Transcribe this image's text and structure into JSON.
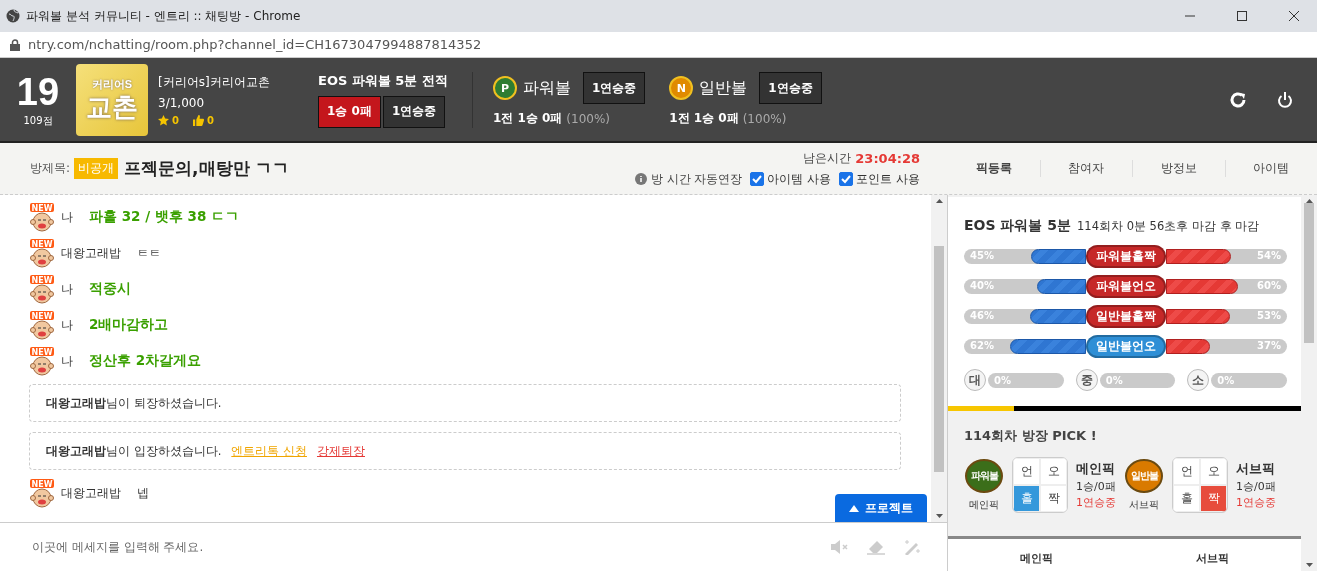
{
  "window": {
    "title": "파워볼 분석 커뮤니티 - 엔트리 :: 채팅방 - Chrome",
    "url": "ntry.com/nchatting/room.php?channel_id=CH1673047994887814352"
  },
  "header": {
    "rank": "19",
    "points": "109점",
    "logo": {
      "top": "커리어S",
      "main": "교촌"
    },
    "room_name": "[커리어s]커리어교촌",
    "members": "3/1,000",
    "stars": "0",
    "likes": "0",
    "record": {
      "title": "EOS 파워볼 5분 전적",
      "result": "1승 0패",
      "streak": "1연승중"
    },
    "balls": [
      {
        "letter": "P",
        "name": "파워볼",
        "streak": "1연승중",
        "summary": "1전 1승 0패",
        "rate": "(100%)",
        "color": "#2e7d32"
      },
      {
        "letter": "N",
        "name": "일반볼",
        "streak": "1연승중",
        "summary": "1전 1승 0패",
        "rate": "(100%)",
        "color": "#e08a00"
      }
    ]
  },
  "room": {
    "label": "방제목:",
    "badge": "비공개",
    "title": "프젝문의,매탕만 ㄱㄱ",
    "time_label": "남은시간",
    "time": "23:04:28",
    "auto_extend": "방 시간 자동연장",
    "options": [
      {
        "label": "아이템 사용",
        "checked": true
      },
      {
        "label": "포인트 사용",
        "checked": true
      }
    ],
    "tabs": [
      {
        "label": "픽등록",
        "selected": true
      },
      {
        "label": "참여자",
        "selected": false
      },
      {
        "label": "방정보",
        "selected": false
      },
      {
        "label": "아이템",
        "selected": false
      }
    ]
  },
  "messages": [
    {
      "kind": "chat",
      "badge": "NEW",
      "name": "나",
      "text": "파홀 32 / 뱃후 38 ㄷㄱ",
      "mine": true
    },
    {
      "kind": "chat",
      "badge": "NEW",
      "name": "대왕고래밥",
      "text": "ㅌㅌ",
      "mine": false
    },
    {
      "kind": "chat",
      "badge": "NEW",
      "name": "나",
      "text": "적중시",
      "mine": true
    },
    {
      "kind": "chat",
      "badge": "NEW",
      "name": "나",
      "text": "2배마감하고",
      "mine": true
    },
    {
      "kind": "chat",
      "badge": "NEW",
      "name": "나",
      "text": "정산후 2차갈게요",
      "mine": true
    },
    {
      "kind": "system",
      "name": "대왕고래밥",
      "text": "님이 퇴장하셨습니다."
    },
    {
      "kind": "system",
      "name": "대왕고래밥",
      "text": "님이 입장하셨습니다.",
      "links": [
        {
          "label": "엔트리톡 신청",
          "color": "#f0a500"
        },
        {
          "label": "강제퇴장",
          "color": "#e53935"
        }
      ]
    },
    {
      "kind": "chat",
      "badge": "NEW",
      "name": "대왕고래밥",
      "text": "넵",
      "mine": false
    }
  ],
  "input": {
    "placeholder": "이곳에 메세지를 입력해 주세요."
  },
  "project_button": "프로젝트",
  "stats": {
    "title": "EOS 파워볼 5분",
    "round_info": "114회차 0분 56초후 마감 후 마감",
    "bars": [
      {
        "label": "파워볼홀짝",
        "color": "#c62828",
        "left": {
          "reading": "45%",
          "level": 0.45
        },
        "right": {
          "reading": "54%",
          "level": 0.54
        }
      },
      {
        "label": "파워볼언오",
        "color": "#c62828",
        "left": {
          "reading": "40%",
          "level": 0.4
        },
        "right": {
          "reading": "60%",
          "level": 0.6
        }
      },
      {
        "label": "일반볼홀짝",
        "color": "#c62828",
        "left": {
          "reading": "46%",
          "level": 0.46
        },
        "right": {
          "reading": "53%",
          "level": 0.53
        }
      },
      {
        "label": "일반볼언오",
        "color": "#2e8fd6",
        "left": {
          "reading": "62%",
          "level": 0.62
        },
        "right": {
          "reading": "37%",
          "level": 0.37
        }
      }
    ],
    "sizes": [
      {
        "label": "대",
        "reading": "0%",
        "level": 0
      },
      {
        "label": "중",
        "reading": "0%",
        "level": 0
      },
      {
        "label": "소",
        "reading": "0%",
        "level": 0
      }
    ]
  },
  "pick": {
    "title": "114회차 방장 PICK !",
    "groups": [
      {
        "ball": "파워볼",
        "color": "#3b6e1a",
        "caption": "메인픽",
        "name": "메인픽",
        "record": "1승/0패",
        "streak": "1연승중",
        "cells": [
          {
            "label": "언",
            "selected": false
          },
          {
            "label": "오",
            "selected": false
          },
          {
            "label": "홀",
            "selected": true
          },
          {
            "label": "짝",
            "selected": false
          }
        ]
      },
      {
        "ball": "일반볼",
        "color": "#d97a00",
        "caption": "서브픽",
        "name": "서브픽",
        "record": "1승/0패",
        "streak": "1연승중",
        "cells": [
          {
            "label": "언",
            "selected": false
          },
          {
            "label": "오",
            "selected": false
          },
          {
            "label": "홀",
            "selected": false
          },
          {
            "label": "짝",
            "selected": true
          }
        ]
      }
    ]
  },
  "table": {
    "columns": [
      "메인픽",
      "서브픽"
    ]
  }
}
